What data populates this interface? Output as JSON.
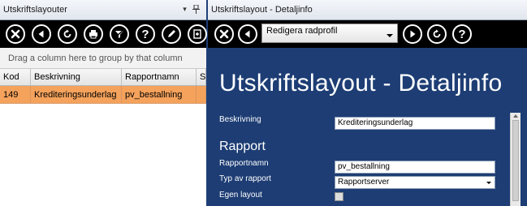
{
  "left": {
    "title": "Utskriftslayouter",
    "toolbar_icons": [
      "close-icon",
      "back-icon",
      "refresh-icon",
      "print-icon",
      "clear-filter-icon",
      "help-icon",
      "edit-icon",
      "export-icon"
    ],
    "group_hint": "Drag a column here to group by that column",
    "columns": [
      "Kod",
      "Beskrivning",
      "Rapportnamn",
      "S"
    ],
    "rows": [
      {
        "kod": "149",
        "beskrivning": "Krediteringsunderlag",
        "rapportnamn": "pv_bestallning",
        "s": ""
      }
    ]
  },
  "right": {
    "title": "Utskriftslayout - Detaljinfo",
    "profile_select": "Redigera radprofil",
    "heading": "Utskriftslayout - Detaljinfo",
    "fields": {
      "beskrivning_label": "Beskrivning",
      "beskrivning_value": "Krediteringsunderlag",
      "section_rapport": "Rapport",
      "rapportnamn_label": "Rapportnamn",
      "rapportnamn_value": "pv_bestallning",
      "typ_label": "Typ av rapport",
      "typ_value": "Rapportserver",
      "egen_layout_label": "Egen layout",
      "egen_layout_checked": false
    }
  },
  "colors": {
    "panel_bg": "#1d3d74",
    "toolbar_bg": "#000000",
    "selected_row": "#f4a25c"
  }
}
